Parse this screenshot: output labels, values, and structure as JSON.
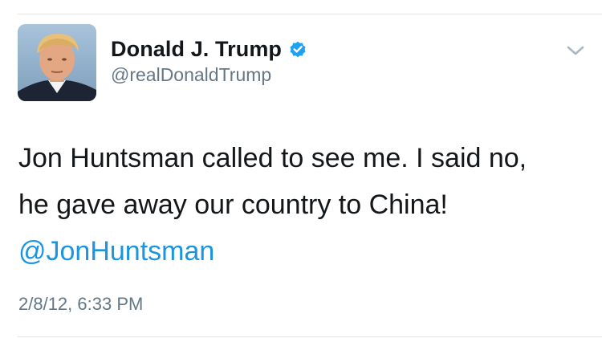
{
  "author": {
    "display_name": "Donald J. Trump",
    "handle": "@realDonaldTrump",
    "verified": true,
    "avatar_icon": "profile-photo"
  },
  "tweet": {
    "text_line_1": "Jon Huntsman called to see me. I said no,",
    "text_line_2": "he gave away our country to China!",
    "mention": "@JonHuntsman",
    "timestamp": "2/8/12, 6:33 PM"
  },
  "icons": {
    "verified": "verified-badge-icon",
    "menu": "chevron-down-icon"
  },
  "colors": {
    "link": "#1b95e0",
    "text": "#14171a",
    "secondary": "#657786",
    "verified": "#1da1f2",
    "divider": "#e1e8ed"
  }
}
